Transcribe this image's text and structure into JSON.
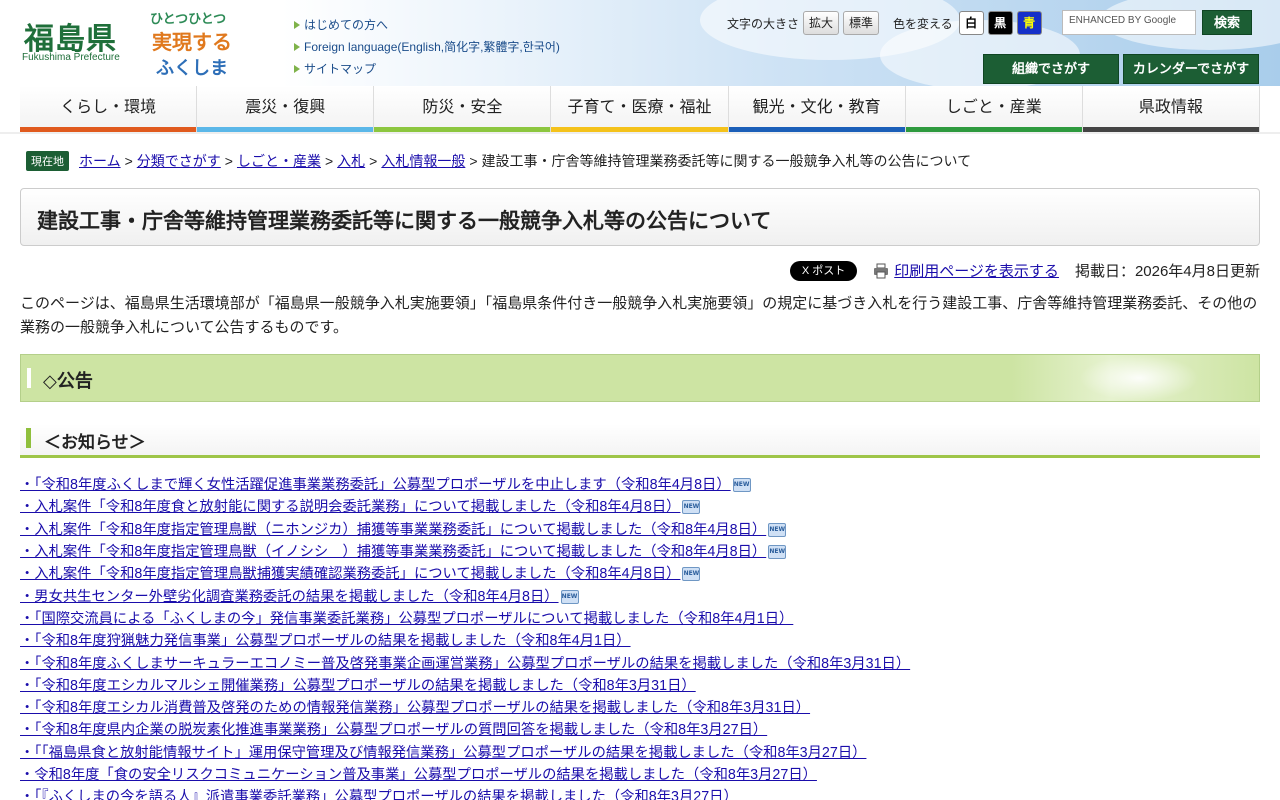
{
  "header": {
    "logo_main": "福島県",
    "logo_sub": "Fukushima Prefecture",
    "slogan": [
      "ひとつひとつ",
      "実現する",
      "ふくしま"
    ],
    "links": [
      "はじめての方へ",
      "Foreign language(English,简化字,繁體字,한국어)",
      "サイトマップ"
    ],
    "text_size_label": "文字の大きさ",
    "text_size_buttons": [
      "拡大",
      "標準"
    ],
    "color_label": "色を変える",
    "color_buttons": [
      "白",
      "黒",
      "青"
    ],
    "search_placeholder": "ENHANCED BY Google",
    "search_button": "検索",
    "nav_buttons": [
      "組織でさがす",
      "カレンダーでさがす"
    ]
  },
  "global_nav": [
    {
      "label": "くらし・環境",
      "color": "#e05a1e"
    },
    {
      "label": "震災・復興",
      "color": "#5bb7e8"
    },
    {
      "label": "防災・安全",
      "color": "#8cc63f"
    },
    {
      "label": "子育て・医療・福祉",
      "color": "#f4c21b"
    },
    {
      "label": "観光・文化・教育",
      "color": "#1b5fb8"
    },
    {
      "label": "しごと・産業",
      "color": "#2e9a3e"
    },
    {
      "label": "県政情報",
      "color": "#444444"
    }
  ],
  "breadcrumb": {
    "badge": "現在地",
    "links": [
      "ホーム",
      "分類でさがす",
      "しごと・産業",
      "入札",
      "入札情報一般"
    ],
    "current": "建設工事・庁舎等維持管理業務委託等に関する一般競争入札等の公告について"
  },
  "page": {
    "title": "建設工事・庁舎等維持管理業務委託等に関する一般競争入札等の公告について",
    "x_post": "X ポスト",
    "print_link": "印刷用ページを表示する",
    "pub_date": "掲載日：2026年4月8日更新",
    "intro": "このページは、福島県生活環境部が「福島県一般競争入札実施要領」「福島県条件付き一般競争入札実施要領」の規定に基づき入札を行う建設工事、庁舎等維持管理業務委託、その他の業務の一般競争入札について公告するものです。",
    "section_h2": "◇公告",
    "section_h3": "＜お知らせ＞"
  },
  "notices": [
    {
      "text": "・「令和8年度ふくしまで輝く女性活躍促進事業業務委託」公募型プロポーザルを中止します（令和8年4月8日）",
      "new": true
    },
    {
      "text": "・入札案件「令和8年度食と放射能に関する説明会委託業務」について掲載しました（令和8年4月8日）",
      "new": true
    },
    {
      "text": "・入札案件「令和8年度指定管理鳥獣（ニホンジカ）捕獲等事業業務委託」について掲載しました（令和8年4月8日）",
      "new": true
    },
    {
      "text": "・入札案件「令和8年度指定管理鳥獣（イノシシ　）捕獲等事業業務委託」について掲載しました（令和8年4月8日）",
      "new": true
    },
    {
      "text": "・入札案件「令和8年度指定管理鳥獣捕獲実績確認業務委託」について掲載しました（令和8年4月8日）",
      "new": true
    },
    {
      "text": "・男女共生センター外壁劣化調査業務委託の結果を掲載しました（令和8年4月8日）",
      "new": true
    },
    {
      "text": "・「国際交流員による「ふくしまの今」発信事業委託業務」公募型プロポーザルについて掲載しました（令和8年4月1日）",
      "new": false
    },
    {
      "text": "・「令和8年度狩猟魅力発信事業」公募型プロポーザルの結果を掲載しました（令和8年4月1日）",
      "new": false
    },
    {
      "text": "・「令和8年度ふくしまサーキュラーエコノミー普及啓発事業企画運営業務」公募型プロポーザルの結果を掲載しました（令和8年3月31日）",
      "new": false
    },
    {
      "text": "・「令和8年度エシカルマルシェ開催業務」公募型プロポーザルの結果を掲載しました（令和8年3月31日）",
      "new": false
    },
    {
      "text": "・「令和8年度エシカル消費普及啓発のための情報発信業務」公募型プロポーザルの結果を掲載しました（令和8年3月31日）",
      "new": false
    },
    {
      "text": "・「令和8年度県内企業の脱炭素化推進事業業務」公募型プロポーザルの質問回答を掲載しました（令和8年3月27日）",
      "new": false
    },
    {
      "text": "・「「福島県食と放射能情報サイト」運用保守管理及び情報発信業務」公募型プロポーザルの結果を掲載しました（令和8年3月27日）",
      "new": false
    },
    {
      "text": "・令和8年度「食の安全リスクコミュニケーション普及事業」公募型プロポーザルの結果を掲載しました（令和8年3月27日）",
      "new": false
    },
    {
      "text": "・「『ふくしまの今を語る人』派遣事業委託業務」公募型プロポーザルの結果を掲載しました（令和8年3月27日）",
      "new": false
    }
  ],
  "new_badge_text": "NEW"
}
